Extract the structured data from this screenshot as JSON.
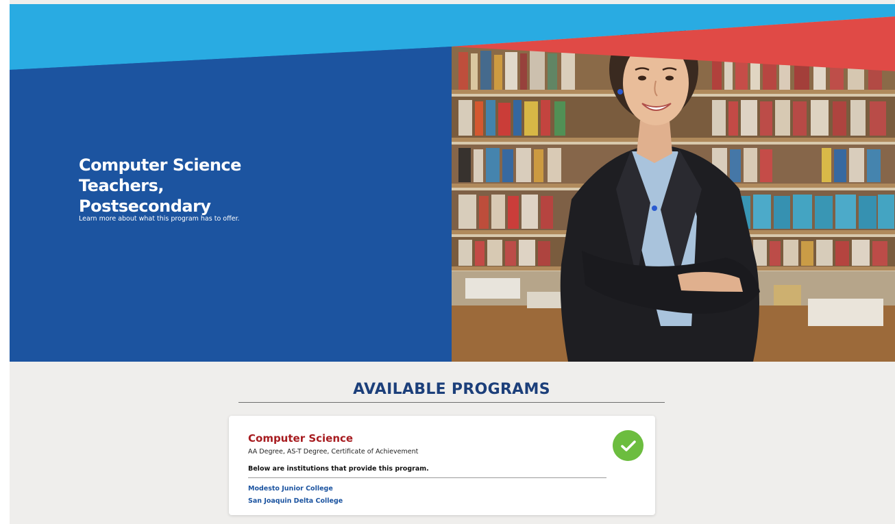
{
  "hero": {
    "title": "Computer Science Teachers, Postsecondary",
    "subtitle": "Learn more about what this program has to offer.",
    "photo_icon": "teacher-photo",
    "colors": {
      "blue": "#1c54a0",
      "sky": "#29abe2",
      "red": "#e04a46"
    }
  },
  "programs": {
    "heading": "AVAILABLE PROGRAMS",
    "items": [
      {
        "title": "Computer Science",
        "degrees": "AA Degree, AS-T Degree, Certificate of Achievement",
        "intro": "Below are institutions that provide this program.",
        "status_icon": "check-circle-icon",
        "institutions": [
          "Modesto Junior College",
          "San Joaquin Delta College"
        ]
      }
    ]
  }
}
